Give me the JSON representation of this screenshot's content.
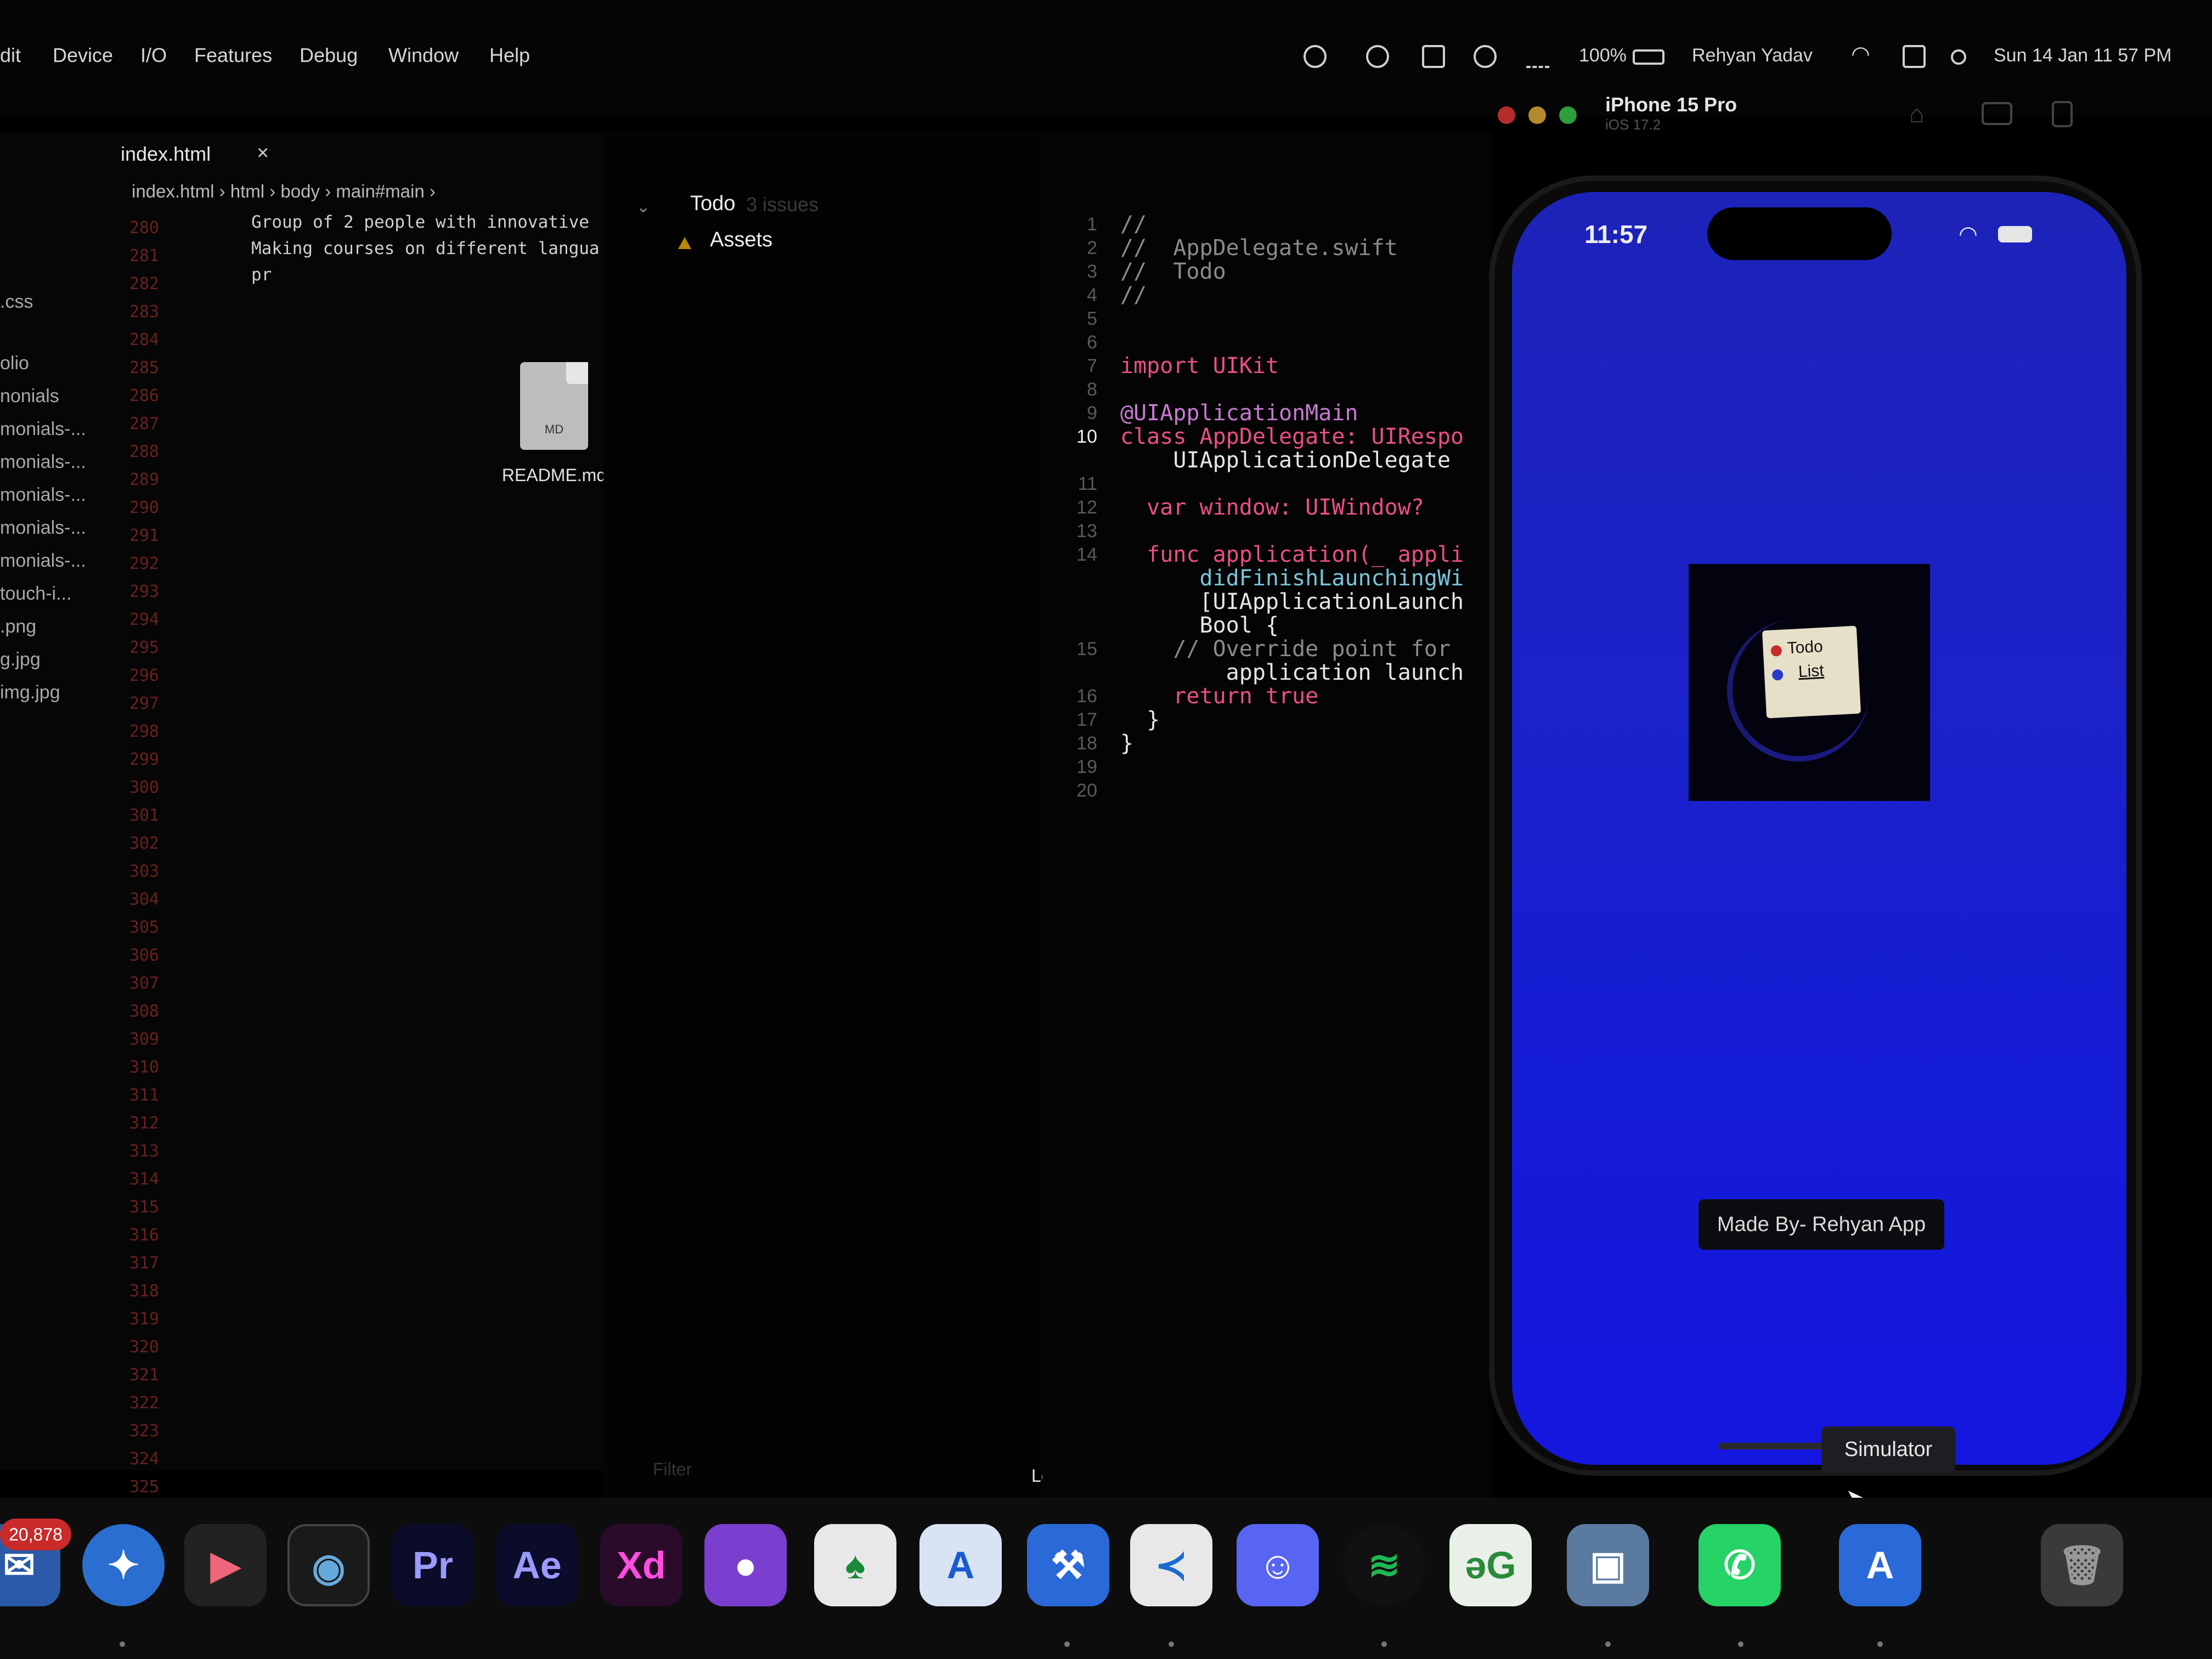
{
  "menubar": {
    "items": [
      "dit",
      "Device",
      "I/O",
      "Features",
      "Debug",
      "Window",
      "Help"
    ],
    "battery": "100%",
    "user": "Rehyan Yadav",
    "datetime": "Sun 14 Jan  11 57 PM"
  },
  "html_editor": {
    "tab": "index.html",
    "breadcrumb": [
      "index.html",
      "html",
      "body",
      "main#main"
    ],
    "files": [
      ".css",
      "olio",
      "nonials",
      "monials-...",
      "monials-...",
      "monials-...",
      "monials-...",
      "monials-...",
      "touch-i...",
      ".png",
      "g.jpg",
      "img.jpg"
    ],
    "line_numbers": [
      "280",
      "281",
      "282",
      "283",
      "284",
      "285",
      "286",
      "287",
      "288",
      "289",
      "290",
      "291",
      "292",
      "293",
      "294",
      "295",
      "296",
      "297",
      "298",
      "299",
      "300",
      "301",
      "302",
      "303",
      "304",
      "305",
      "306",
      "307",
      "308",
      "309",
      "310",
      "311",
      "312",
      "313",
      "314",
      "315",
      "316",
      "317",
      "318",
      "319",
      "320",
      "321",
      "322",
      "323",
      "324",
      "325"
    ],
    "line1": "Group of 2 people with innovative",
    "line2": "Making courses on different langua",
    "line3": "pr"
  },
  "finder": {
    "readme_label": "README.md",
    "readme_badge": "MD"
  },
  "xcode": {
    "project": "Todo",
    "issues": "3 issues",
    "group": "Assets",
    "filter_placeholder": "Filter",
    "scheme": "Local"
  },
  "swift": {
    "lines": [
      {
        "n": "1",
        "t": "//"
      },
      {
        "n": "2",
        "t": "//  AppDelegate.swift"
      },
      {
        "n": "3",
        "t": "//  Todo"
      },
      {
        "n": "4",
        "t": "//"
      },
      {
        "n": "5",
        "t": ""
      },
      {
        "n": "6",
        "t": ""
      },
      {
        "n": "7",
        "t": "import UIKit"
      },
      {
        "n": "8",
        "t": ""
      },
      {
        "n": "9",
        "t": "@UIApplicationMain"
      },
      {
        "n": "10",
        "t": "class AppDelegate: UIRespo"
      },
      {
        "n": "",
        "t": "    UIApplicationDelegate"
      },
      {
        "n": "11",
        "t": ""
      },
      {
        "n": "12",
        "t": "  var window: UIWindow?"
      },
      {
        "n": "13",
        "t": ""
      },
      {
        "n": "14",
        "t": "  func application(_ appli"
      },
      {
        "n": "",
        "t": "      didFinishLaunchingWi"
      },
      {
        "n": "",
        "t": "      [UIApplicationLaunch"
      },
      {
        "n": "",
        "t": "      Bool {"
      },
      {
        "n": "15",
        "t": "    // Override point for"
      },
      {
        "n": "",
        "t": "        application launch"
      },
      {
        "n": "16",
        "t": "    return true"
      },
      {
        "n": "17",
        "t": "  }"
      },
      {
        "n": "18",
        "t": "}"
      },
      {
        "n": "19",
        "t": ""
      },
      {
        "n": "20",
        "t": ""
      }
    ]
  },
  "simulator": {
    "device": "iPhone 15 Pro",
    "os": "iOS 17.2",
    "time": "11:57",
    "icon_line1": "Todo",
    "icon_line2": "List",
    "footer": "Made By- Rehyan App",
    "tooltip": "Simulator"
  },
  "dock": {
    "mail_badge": "20,878",
    "apps": [
      "Mail",
      "Safari",
      "Final Cut Pro",
      "DaVinci Resolve",
      "Premiere Pro",
      "After Effects",
      "Adobe XD",
      "GitHub Desktop",
      "MongoDB Compass",
      "Instruments",
      "Xcode",
      "Visual Studio Code",
      "Discord",
      "Spotify",
      "GeeksforGeeks",
      "Preview",
      "WhatsApp",
      "Simulator",
      "Trash"
    ],
    "pr": "Pr",
    "ae": "Ae",
    "xd": "Xd"
  }
}
